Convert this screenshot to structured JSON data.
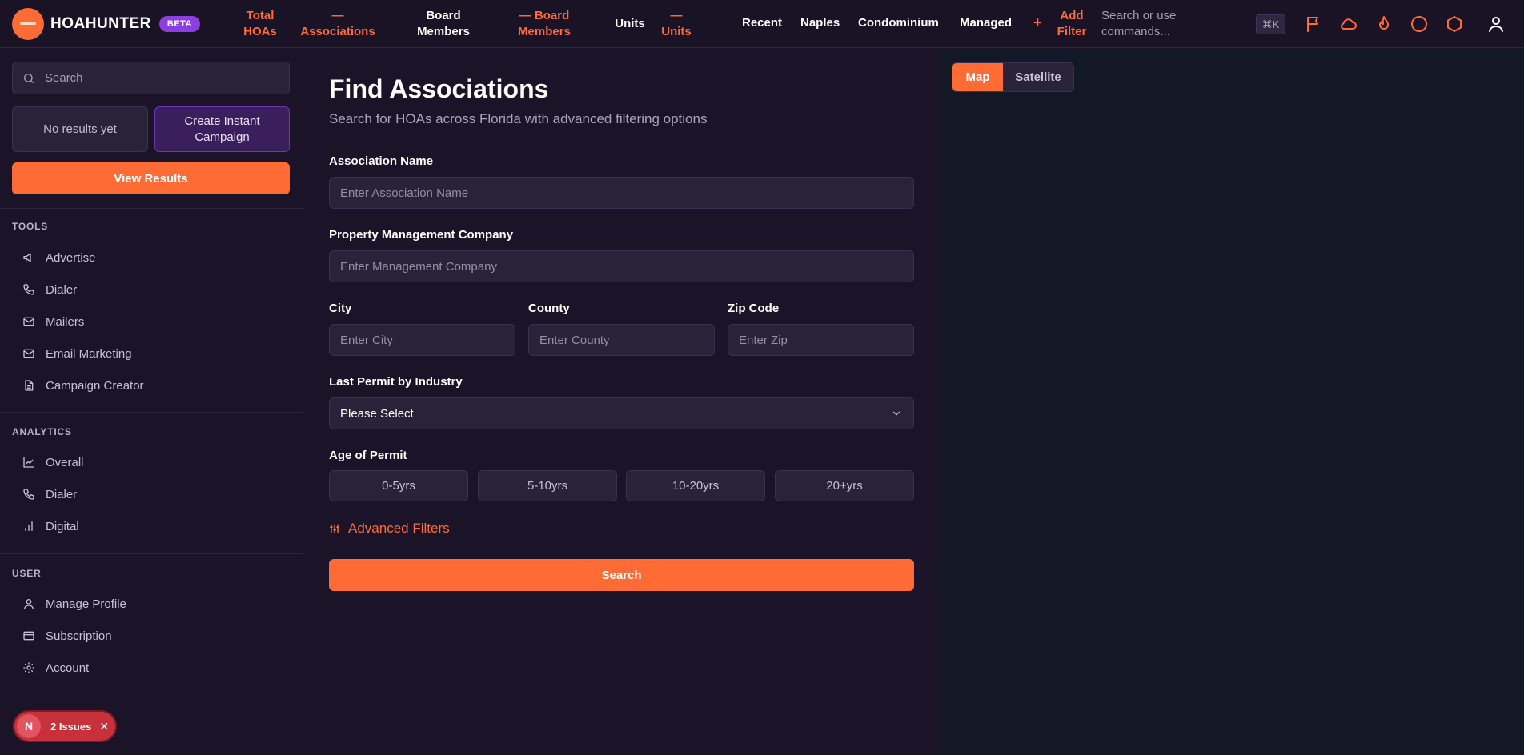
{
  "brand": {
    "name": "HOAHUNTER",
    "badge": "BETA"
  },
  "topbar": {
    "stats": [
      {
        "line1": "Total",
        "line2": "HOAs"
      },
      {
        "line1": "—",
        "line2": "Associations"
      },
      {
        "line1": "Board",
        "line2": "Members"
      },
      {
        "line1": "— Board",
        "line2": "Members"
      },
      {
        "line1": "Units",
        "line2": ""
      },
      {
        "line1": "—",
        "line2": "Units"
      }
    ],
    "chips": [
      "Recent",
      "Naples",
      "Condominium",
      "Managed"
    ],
    "plus": "+",
    "add_filter": {
      "line1": "Add",
      "line2": "Filter"
    },
    "command_placeholder": {
      "line1": "Search or use",
      "line2": "commands..."
    },
    "shortcut": "⌘K",
    "icons": [
      "flag-icon",
      "cloud-icon",
      "flame-icon",
      "circle-icon",
      "hexagon-icon",
      "user-icon"
    ]
  },
  "sidebar": {
    "search_placeholder": "Search",
    "no_results": "No results yet",
    "instant_campaign": {
      "line1": "Create Instant",
      "line2": "Campaign"
    },
    "view_results": "View Results",
    "sections": [
      {
        "heading": "TOOLS",
        "items": [
          {
            "label": "Advertise",
            "icon": "megaphone-icon"
          },
          {
            "label": "Dialer",
            "icon": "phone-icon"
          },
          {
            "label": "Mailers",
            "icon": "mail-icon"
          },
          {
            "label": "Email Marketing",
            "icon": "mail-icon"
          },
          {
            "label": "Campaign Creator",
            "icon": "document-icon"
          }
        ]
      },
      {
        "heading": "ANALYTICS",
        "items": [
          {
            "label": "Overall",
            "icon": "line-chart-icon"
          },
          {
            "label": "Dialer",
            "icon": "phone-icon"
          },
          {
            "label": "Digital",
            "icon": "bar-chart-icon"
          }
        ]
      },
      {
        "heading": "USER",
        "items": [
          {
            "label": "Manage Profile",
            "icon": "user-icon"
          },
          {
            "label": "Subscription",
            "icon": "credit-card-icon"
          },
          {
            "label": "Account",
            "icon": "gear-icon"
          }
        ]
      }
    ],
    "issues": {
      "badge": "N",
      "label": "2 Issues",
      "close": "✕"
    }
  },
  "form": {
    "title": "Find Associations",
    "subtitle": "Search for HOAs across Florida with advanced filtering options",
    "association_name": {
      "label": "Association Name",
      "placeholder": "Enter Association Name"
    },
    "management_company": {
      "label": "Property Management Company",
      "placeholder": "Enter Management Company"
    },
    "city": {
      "label": "City",
      "placeholder": "Enter City"
    },
    "county": {
      "label": "County",
      "placeholder": "Enter County"
    },
    "zip": {
      "label": "Zip Code",
      "placeholder": "Enter Zip"
    },
    "permit_industry": {
      "label": "Last Permit by Industry",
      "value": "Please Select"
    },
    "permit_age": {
      "label": "Age of Permit",
      "options": [
        "0-5yrs",
        "5-10yrs",
        "10-20yrs",
        "20+yrs"
      ]
    },
    "advanced_filters": "Advanced Filters",
    "search_button": "Search"
  },
  "map": {
    "toggle": [
      "Map",
      "Satellite"
    ],
    "selected": "Map"
  },
  "colors": {
    "accent": "#ff6b35",
    "purple": "#8b3fe0",
    "bg": "#1b1428",
    "map_bg": "#131826"
  }
}
